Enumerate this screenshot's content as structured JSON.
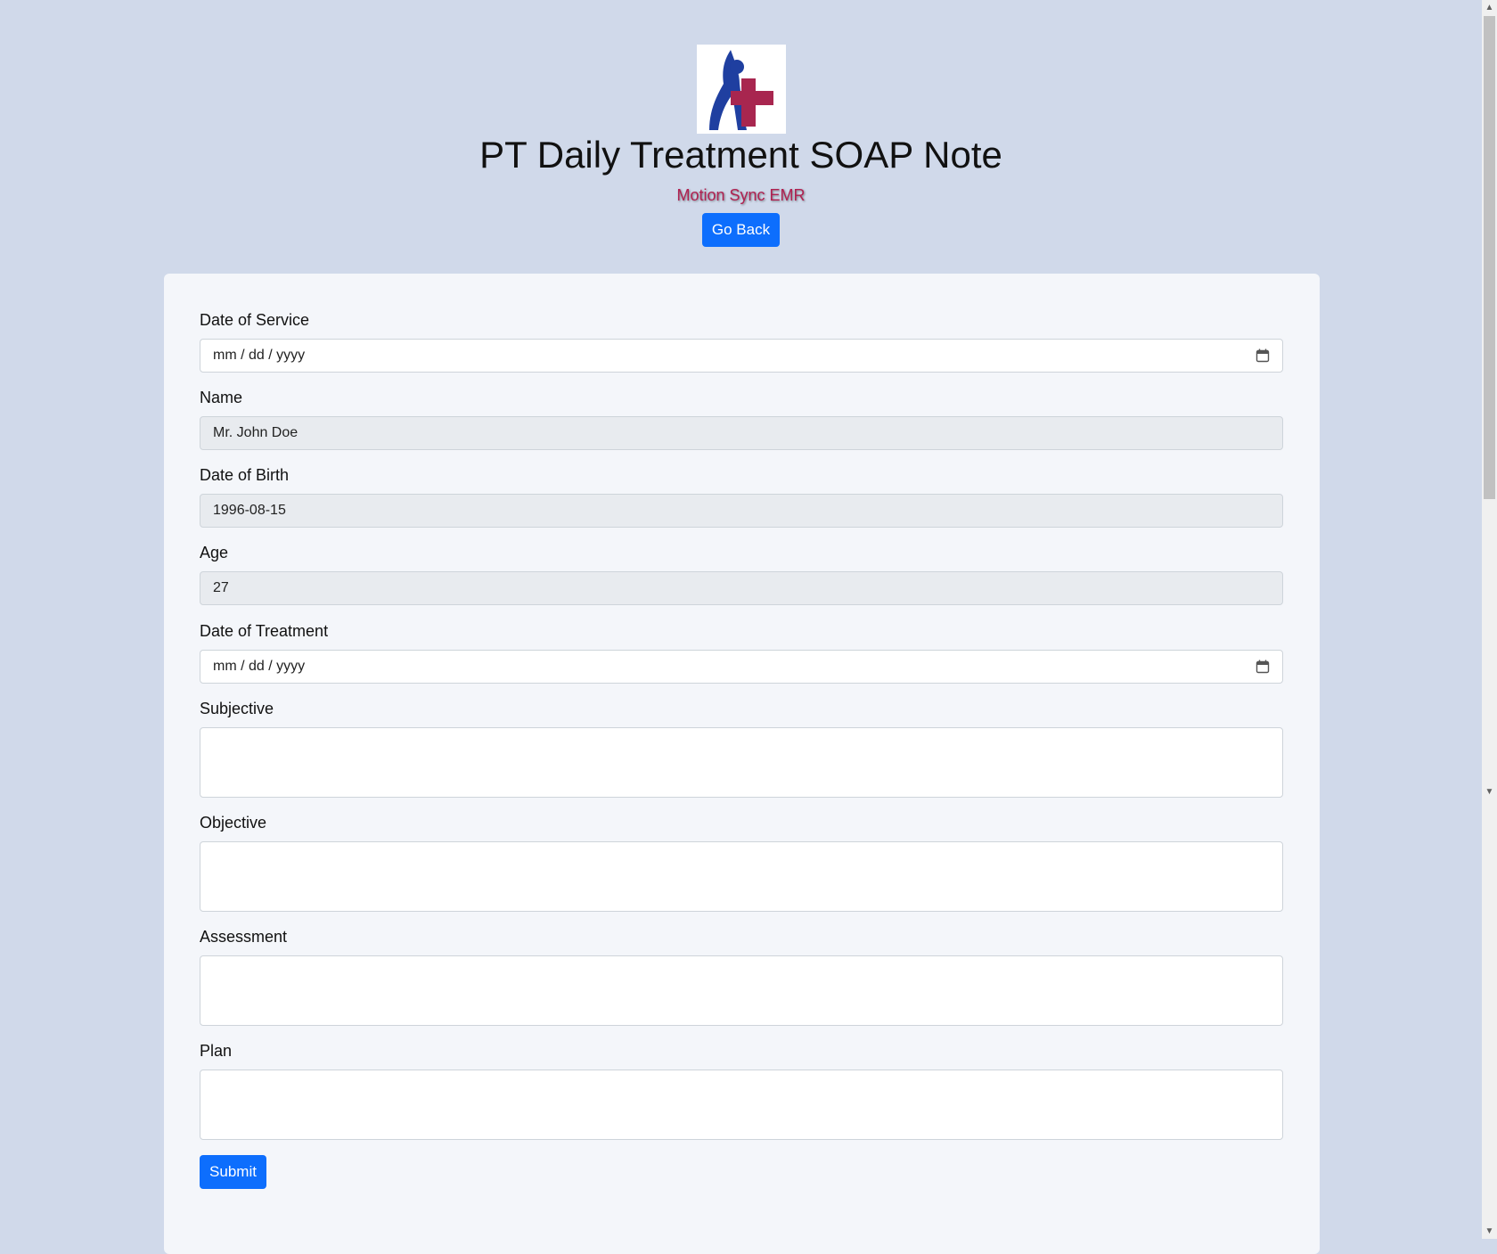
{
  "header": {
    "logo_name": "medical-figure-cross-logo",
    "title": "PT Daily Treatment SOAP Note",
    "subtitle": "Motion Sync EMR",
    "go_back_label": "Go Back"
  },
  "form": {
    "date_of_service": {
      "label": "Date of Service",
      "placeholder": "mm / dd / yyyy",
      "value": ""
    },
    "name": {
      "label": "Name",
      "value": "Mr. John Doe"
    },
    "date_of_birth": {
      "label": "Date of Birth",
      "value": "1996-08-15"
    },
    "age": {
      "label": "Age",
      "value": "27"
    },
    "date_of_treatment": {
      "label": "Date of Treatment",
      "placeholder": "mm / dd / yyyy",
      "value": ""
    },
    "subjective": {
      "label": "Subjective",
      "value": ""
    },
    "objective": {
      "label": "Objective",
      "value": ""
    },
    "assessment": {
      "label": "Assessment",
      "value": ""
    },
    "plan": {
      "label": "Plan",
      "value": ""
    },
    "submit_label": "Submit"
  },
  "colors": {
    "page_bg": "#d0d9ea",
    "card_bg": "#f4f6fa",
    "primary": "#0d6efd",
    "brand_red": "#b02050",
    "logo_blue": "#1f3fa0",
    "logo_red": "#a8264f"
  }
}
